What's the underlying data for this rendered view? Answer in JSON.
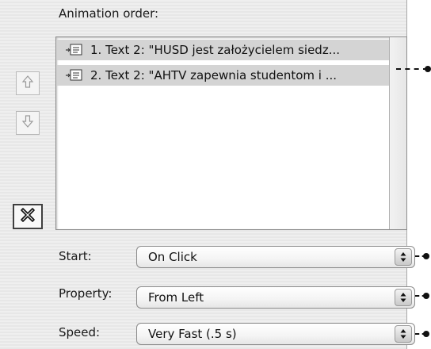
{
  "animation_order": {
    "label": "Animation order:",
    "items": [
      {
        "text": "1. Text 2: \"HUSD jest założycielem siedz...",
        "icon": "text-build-icon"
      },
      {
        "text": "2. Text 2: \"AHTV zapewnia studentom i ...",
        "icon": "text-build-icon"
      }
    ]
  },
  "side_buttons": {
    "move_up_icon": "up-arrow-icon",
    "move_down_icon": "down-arrow-icon",
    "delete_icon": "x-icon"
  },
  "fields": [
    {
      "label": "Start:",
      "value": "On Click"
    },
    {
      "label": "Property:",
      "value": "From Left"
    },
    {
      "label": "Speed:",
      "value": "Very Fast (.5 s)"
    }
  ],
  "colors": {
    "selection": "#d4d4d4",
    "callout": "#111111"
  }
}
